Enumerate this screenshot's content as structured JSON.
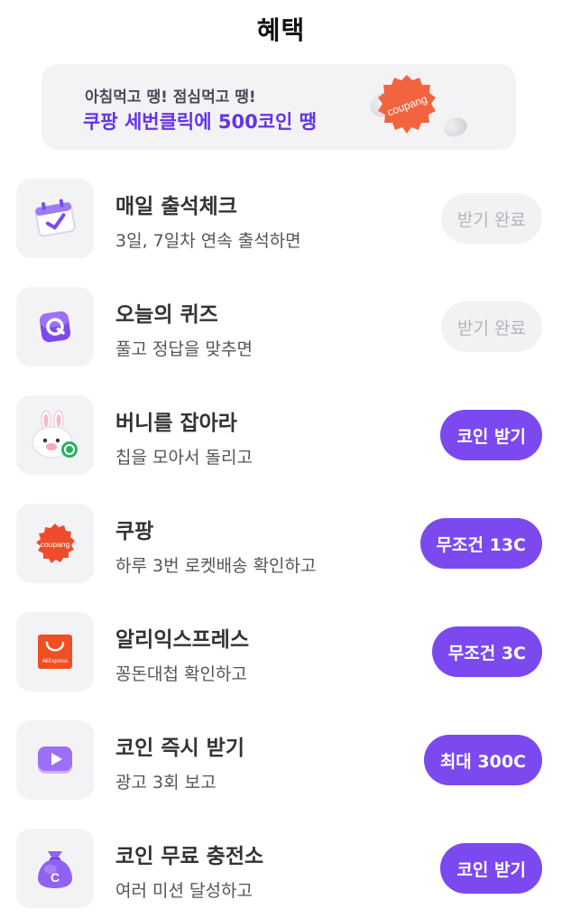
{
  "header": {
    "title": "혜택"
  },
  "banner": {
    "line1": "아침먹고 땡! 점심먹고 땡!",
    "line2": "쿠팡 세번클릭에 500코인 땡",
    "coin_label": "coupang"
  },
  "benefits": [
    {
      "name": "매일 출석체크",
      "desc": "3일, 7일차 연속 출석하면",
      "button": "받기 완료",
      "state": "done",
      "icon": "calendar-check-icon"
    },
    {
      "name": "오늘의 퀴즈",
      "desc": "풀고 정답을 맞추면",
      "button": "받기 완료",
      "state": "done",
      "icon": "quiz-q-icon"
    },
    {
      "name": "버니를 잡아라",
      "desc": "칩을 모아서 돌리고",
      "button": "코인 받기",
      "state": "active",
      "icon": "bunny-icon"
    },
    {
      "name": "쿠팡",
      "desc": "하루 3번 로켓배송 확인하고",
      "button": "무조건 13C",
      "state": "active",
      "icon": "coupang-logo-icon",
      "icon_label": "coupang"
    },
    {
      "name": "알리익스프레스",
      "desc": "꽁돈대첩 확인하고",
      "button": "무조건 3C",
      "state": "active",
      "icon": "aliexpress-bag-icon",
      "icon_label": "AliExpress"
    },
    {
      "name": "코인 즉시 받기",
      "desc": "광고 3회 보고",
      "button": "최대 300C",
      "state": "active",
      "icon": "video-play-icon"
    },
    {
      "name": "코인 무료 충전소",
      "desc": "여러 미션 달성하고",
      "button": "코인 받기",
      "state": "active",
      "icon": "coin-bag-icon"
    }
  ],
  "colors": {
    "accent": "#7b49ef",
    "banner_text": "#6533e8",
    "done_bg": "#f2f2f4",
    "icon_bg": "#f3f3f6",
    "coupang_red": "#ee4d2d"
  }
}
